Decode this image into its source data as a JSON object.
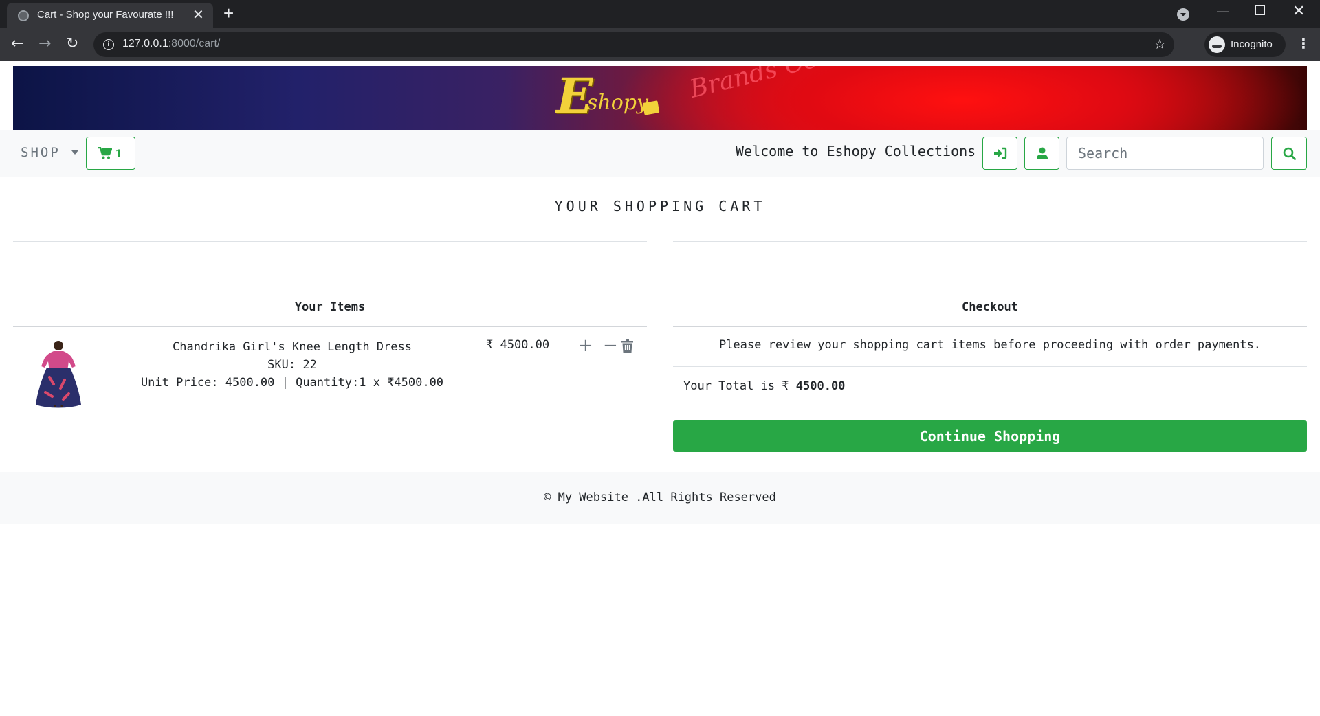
{
  "browser": {
    "tab_title": "Cart - Shop your Favourate !!!",
    "url_host": "127.0.0.1",
    "url_path": ":8000/cart/",
    "profile_label": "Incognito"
  },
  "banner": {
    "logo_initial": "E",
    "logo_text": "shopy",
    "tagline": "Brands Collections"
  },
  "navbar": {
    "shop_label": "SHOP",
    "cart_count": "1",
    "welcome_text": "Welcome to Eshopy Collections",
    "search_placeholder": "Search"
  },
  "cart": {
    "title": "YOUR SHOPPING CART",
    "items_heading": "Your Items",
    "items": [
      {
        "name": "Chandrika Girl's Knee Length Dress",
        "sku": "SKU: 22",
        "unit_line": "Unit Price: 4500.00 | Quantity:1 x ₹4500.00",
        "price": "₹ 4500.00"
      }
    ]
  },
  "checkout": {
    "heading": "Checkout",
    "note": "Please review your shopping cart items before proceeding with order payments.",
    "total_label": "Your Total is ₹ ",
    "total_value": "4500.00",
    "continue_label": "Continue Shopping"
  },
  "footer": {
    "text": "© My Website .All Rights Reserved"
  },
  "colors": {
    "success": "#28a745",
    "navbar_bg": "#f8f9fa",
    "chrome_dark": "#202124"
  }
}
